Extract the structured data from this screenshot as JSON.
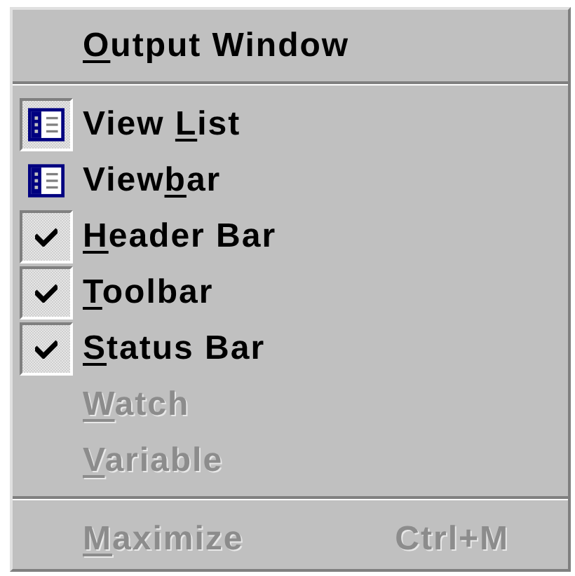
{
  "menu": {
    "items": [
      {
        "kind": "plain",
        "label": [
          {
            "text": "O",
            "underline": true
          },
          {
            "text": "utput Window",
            "underline": false
          }
        ],
        "disabled": false
      },
      {
        "kind": "separator"
      },
      {
        "kind": "icon",
        "label": [
          {
            "text": "View ",
            "underline": false
          },
          {
            "text": "L",
            "underline": true
          },
          {
            "text": "ist",
            "underline": false
          }
        ],
        "checked": true,
        "disabled": false
      },
      {
        "kind": "icon",
        "label": [
          {
            "text": "View",
            "underline": false
          },
          {
            "text": "b",
            "underline": true
          },
          {
            "text": "ar",
            "underline": false
          }
        ],
        "checked": false,
        "disabled": false
      },
      {
        "kind": "check",
        "label": [
          {
            "text": "H",
            "underline": true
          },
          {
            "text": "eader Bar",
            "underline": false
          }
        ],
        "checked": true,
        "disabled": false
      },
      {
        "kind": "check",
        "label": [
          {
            "text": "T",
            "underline": true
          },
          {
            "text": "oolbar",
            "underline": false
          }
        ],
        "checked": true,
        "disabled": false
      },
      {
        "kind": "check",
        "label": [
          {
            "text": "S",
            "underline": true
          },
          {
            "text": "tatus Bar",
            "underline": false
          }
        ],
        "checked": true,
        "disabled": false
      },
      {
        "kind": "plain",
        "label": [
          {
            "text": "W",
            "underline": true
          },
          {
            "text": "atch",
            "underline": false
          }
        ],
        "disabled": true
      },
      {
        "kind": "plain",
        "label": [
          {
            "text": "V",
            "underline": true
          },
          {
            "text": "ariable",
            "underline": false
          }
        ],
        "disabled": true
      },
      {
        "kind": "separator"
      },
      {
        "kind": "plain",
        "label": [
          {
            "text": "M",
            "underline": true
          },
          {
            "text": "aximize",
            "underline": false
          }
        ],
        "shortcut": "Ctrl+M",
        "disabled": true
      }
    ]
  }
}
